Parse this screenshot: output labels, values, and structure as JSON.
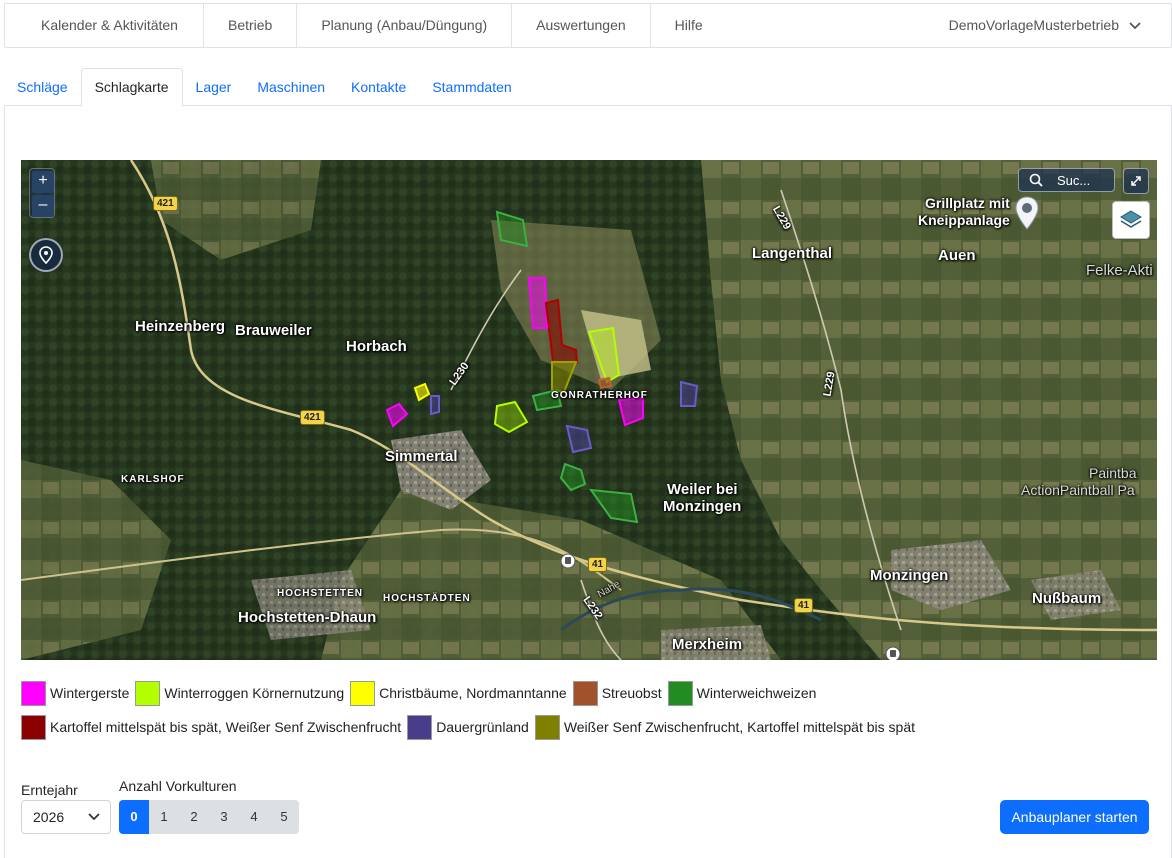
{
  "topnav": {
    "items": [
      "Kalender & Aktivitäten",
      "Betrieb",
      "Planung (Anbau/Düngung)",
      "Auswertungen",
      "Hilfe"
    ],
    "user": "DemoVorlageMusterbetrieb"
  },
  "tabs": [
    "Schläge",
    "Schlagkarte",
    "Lager",
    "Maschinen",
    "Kontakte",
    "Stammdaten"
  ],
  "active_tab": "Schlagkarte",
  "map": {
    "search_label": "Suc...",
    "zoom_in": "+",
    "zoom_out": "–",
    "poi_label": "Grillplatz mit\nKneippanlage",
    "places": {
      "heinzenberg": "Heinzenberg",
      "brauweiler": "Brauweiler",
      "horbach": "Horbach",
      "simmertal": "Simmertal",
      "karlshof": "KARLSHOF",
      "hochstetten": "HOCHSTETTEN",
      "hochstaedten": "HOCHSTÄDTEN",
      "hochstetten_dhaun": "Hochstetten-Dhaun",
      "gonratherhof": "GONRATHERHOF",
      "langenthal": "Langenthal",
      "auen": "Auen",
      "felke": "Felke-Akti",
      "weiler1": "Weiler bei",
      "weiler2": "Monzingen",
      "monzingen": "Monzingen",
      "nussbaum": "Nußbaum",
      "merxheim": "Merxheim",
      "paintba": "Paintba",
      "actionpaintball": "ActionPaintball Pa",
      "nahe": "Nahe"
    },
    "roads": {
      "r421a": "421",
      "r421b": "421",
      "l230": "L230",
      "l229a": "L229",
      "l229b": "L229",
      "l232": "L232",
      "r41a": "41",
      "r41b": "41"
    }
  },
  "legend": {
    "rows": [
      [
        {
          "label": "Wintergerste",
          "color": "#ff00ff"
        },
        {
          "label": "Winterroggen Körnernutzung",
          "color": "#b3ff00"
        },
        {
          "label": "Christbäume, Nordmanntanne",
          "color": "#ffff00"
        },
        {
          "label": "Streuobst",
          "color": "#a0522d"
        },
        {
          "label": "Winterweichweizen",
          "color": "#228b22"
        }
      ],
      [
        {
          "label": "Kartoffel mittelspät bis spät, Weißer Senf Zwischenfrucht",
          "color": "#8b0000"
        },
        {
          "label": "Dauergrünland",
          "color": "#483d8b"
        },
        {
          "label": "Weißer Senf Zwischenfrucht, Kartoffel mittelspät bis spät",
          "color": "#808000"
        }
      ]
    ]
  },
  "controls": {
    "erntejahr_label": "Erntejahr",
    "erntejahr_value": "2026",
    "vorkulturen_label": "Anzahl Vorkulturen",
    "vorkulturen_options": [
      "0",
      "1",
      "2",
      "3",
      "4",
      "5"
    ],
    "vorkulturen_selected": "0",
    "start_button": "Anbauplaner starten"
  }
}
